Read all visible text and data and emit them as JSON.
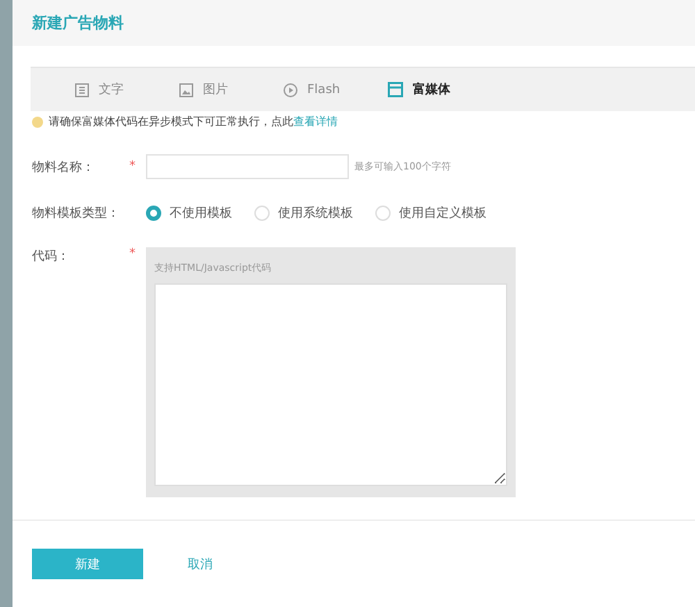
{
  "dialog": {
    "title": "新建广告物料"
  },
  "tabs": [
    {
      "label": "文字",
      "kind": "text",
      "selected": false
    },
    {
      "label": "图片",
      "kind": "image",
      "selected": false
    },
    {
      "label": "Flash",
      "kind": "video",
      "selected": false
    },
    {
      "label": "富媒体",
      "kind": "richmedia",
      "selected": true
    }
  ],
  "notice": {
    "text": "请确保富媒体代码在异步模式下可正常执行，点此",
    "link": "查看详情"
  },
  "name_field": {
    "label": "物料名称：",
    "required_mark": "*",
    "hint": "最多可输入100个字符"
  },
  "template_type": {
    "label": "物料模板类型：",
    "options": [
      {
        "label": "不使用模板",
        "selected": true
      },
      {
        "label": "使用系统模板",
        "selected": false
      },
      {
        "label": "使用自定义模板",
        "selected": false
      }
    ]
  },
  "code_field": {
    "label": "代码：",
    "required_mark": "*",
    "caption": "支持HTML/Javascript代码"
  },
  "buttons": [
    {
      "label": "新建",
      "kind": "primary"
    },
    {
      "label": "取消",
      "kind": "link"
    }
  ]
}
